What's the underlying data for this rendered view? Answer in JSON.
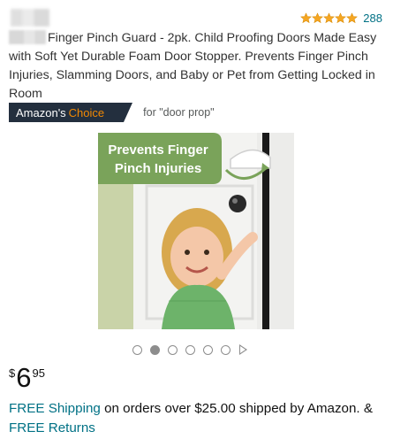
{
  "rating": {
    "stars": 5,
    "count": "288"
  },
  "product": {
    "title": "Finger Pinch Guard - 2pk. Child Proofing Doors Made Easy with Soft Yet Durable Foam Door Stopper. Prevents Finger Pinch Injuries, Slamming Doors, and Baby or Pet from Getting Locked in Room"
  },
  "badge": {
    "brand": "Amazon's",
    "choice": "Choice",
    "for_text": "for \"door prop\""
  },
  "image": {
    "overlay_line1": "Prevents Finger",
    "overlay_line2": "Pinch Injuries"
  },
  "carousel": {
    "dots": 6,
    "active_index": 1
  },
  "price": {
    "symbol": "$",
    "whole": "6",
    "fraction": "95"
  },
  "shipping": {
    "free_shipping": "FREE Shipping",
    "text": " on orders over $25.00 shipped by Amazon. & ",
    "free_returns": "FREE Returns"
  },
  "colors": {
    "link": "#007185",
    "badge_bg": "#232f3e",
    "badge_choice": "#f08804",
    "star": "#f5a623"
  }
}
